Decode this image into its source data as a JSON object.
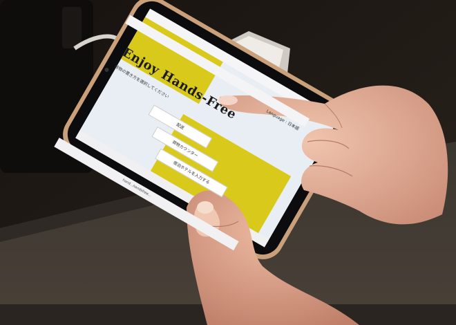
{
  "phone_screen": {
    "status_bar": {
      "carrier": "",
      "time": ""
    },
    "language_selector": "Language : 日本語",
    "hero_title": "Enjoy Hands-Free",
    "subtitle": "荷物の置き方を選択してください",
    "buttons": [
      {
        "label": "配送"
      },
      {
        "label": "荷物カウンター"
      },
      {
        "label": "宿泊ホテルを入力する"
      }
    ],
    "url": "hand...handsfree..."
  },
  "colors": {
    "screen_yellow": "#d9c91a",
    "screen_bg": "#e8eef3",
    "phone_case": "#c98a55",
    "skin": "#e6b199",
    "table": "#3f3a34",
    "background": "#1e1a17"
  }
}
